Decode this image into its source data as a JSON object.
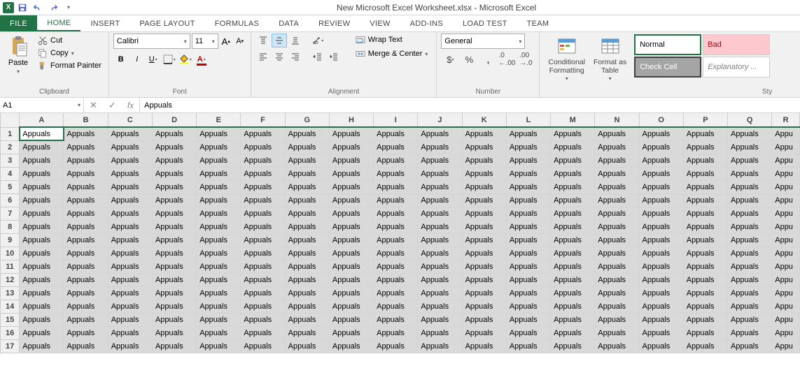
{
  "app": {
    "title": "New Microsoft Excel Worksheet.xlsx - Microsoft Excel"
  },
  "tabs": {
    "file": "FILE",
    "home": "HOME",
    "insert": "INSERT",
    "pageLayout": "PAGE LAYOUT",
    "formulas": "FORMULAS",
    "data": "DATA",
    "review": "REVIEW",
    "view": "VIEW",
    "addins": "ADD-INS",
    "loadtest": "LOAD TEST",
    "team": "TEAM"
  },
  "ribbon": {
    "clipboard": {
      "label": "Clipboard",
      "paste": "Paste",
      "cut": "Cut",
      "copy": "Copy",
      "formatPainter": "Format Painter"
    },
    "font": {
      "label": "Font",
      "name": "Calibri",
      "size": "11"
    },
    "alignment": {
      "label": "Alignment",
      "wrapText": "Wrap Text",
      "mergeCenter": "Merge & Center"
    },
    "number": {
      "label": "Number",
      "format": "General"
    },
    "styles": {
      "label": "Sty",
      "conditional": "Conditional\nFormatting",
      "formatAs": "Format as\nTable",
      "normal": "Normal",
      "checkCell": "Check Cell",
      "bad": "Bad",
      "explanatory": "Explanatory ..."
    }
  },
  "formulaBar": {
    "nameBox": "A1",
    "formula": "Appuals"
  },
  "grid": {
    "columns": [
      "A",
      "B",
      "C",
      "D",
      "E",
      "F",
      "G",
      "H",
      "I",
      "J",
      "K",
      "L",
      "M",
      "N",
      "O",
      "P",
      "Q",
      "R"
    ],
    "rowCount": 17,
    "cellValue": "Appuals",
    "lastColValue": "Appu",
    "activeCell": {
      "row": 1,
      "col": "A"
    }
  }
}
